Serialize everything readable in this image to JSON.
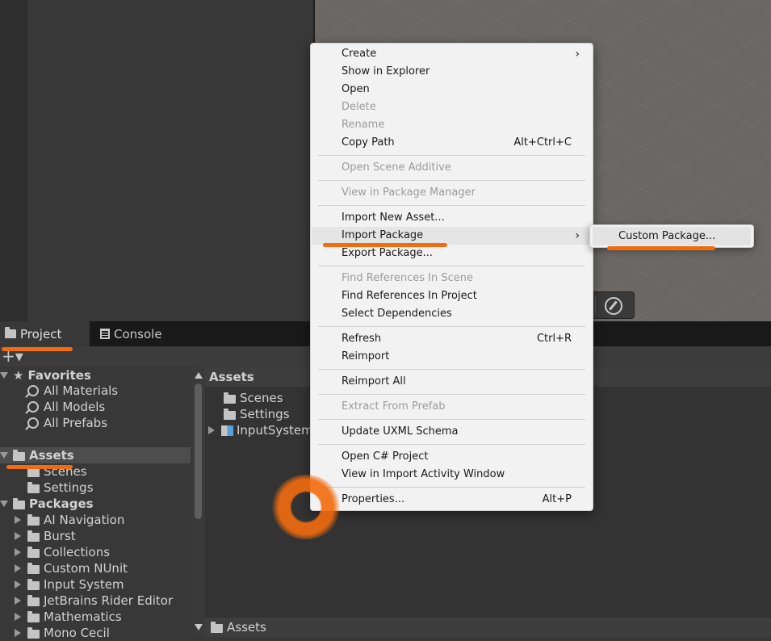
{
  "tabs": {
    "project": "Project",
    "console": "Console"
  },
  "toolbar": {
    "add_label": "+▾"
  },
  "tree": {
    "favorites": "Favorites",
    "favorite_items": [
      "All Materials",
      "All Models",
      "All Prefabs"
    ],
    "assets": "Assets",
    "asset_children": [
      "Scenes",
      "Settings"
    ],
    "packages": "Packages",
    "package_items": [
      "AI Navigation",
      "Burst",
      "Collections",
      "Custom NUnit",
      "Input System",
      "JetBrains Rider Editor",
      "Mathematics",
      "Mono Cecil"
    ]
  },
  "content": {
    "header": "Assets",
    "items": [
      "Scenes",
      "Settings",
      "InputSystem"
    ],
    "footer": "Assets"
  },
  "context_menu": {
    "items": [
      {
        "label": "Create",
        "shortcut": "",
        "submenu": true,
        "disabled": false
      },
      {
        "label": "Show in Explorer",
        "shortcut": "",
        "disabled": false
      },
      {
        "label": "Open",
        "shortcut": "",
        "disabled": false
      },
      {
        "label": "Delete",
        "shortcut": "",
        "disabled": true
      },
      {
        "label": "Rename",
        "shortcut": "",
        "disabled": true
      },
      {
        "label": "Copy Path",
        "shortcut": "Alt+Ctrl+C",
        "disabled": false
      },
      {
        "label": "Open Scene Additive",
        "shortcut": "",
        "disabled": true
      },
      {
        "label": "View in Package Manager",
        "shortcut": "",
        "disabled": true
      },
      {
        "label": "Import New Asset...",
        "shortcut": "",
        "disabled": false
      },
      {
        "label": "Import Package",
        "shortcut": "",
        "submenu": true,
        "disabled": false,
        "highlighted": true
      },
      {
        "label": "Export Package...",
        "shortcut": "",
        "disabled": false
      },
      {
        "label": "Find References In Scene",
        "shortcut": "",
        "disabled": true
      },
      {
        "label": "Find References In Project",
        "shortcut": "",
        "disabled": false
      },
      {
        "label": "Select Dependencies",
        "shortcut": "",
        "disabled": false
      },
      {
        "label": "Refresh",
        "shortcut": "Ctrl+R",
        "disabled": false
      },
      {
        "label": "Reimport",
        "shortcut": "",
        "disabled": false
      },
      {
        "label": "Reimport All",
        "shortcut": "",
        "disabled": false
      },
      {
        "label": "Extract From Prefab",
        "shortcut": "",
        "disabled": true
      },
      {
        "label": "Update UXML Schema",
        "shortcut": "",
        "disabled": false
      },
      {
        "label": "Open C# Project",
        "shortcut": "",
        "disabled": false
      },
      {
        "label": "View in Import Activity Window",
        "shortcut": "",
        "disabled": false
      },
      {
        "label": "Properties...",
        "shortcut": "Alt+P",
        "disabled": false
      }
    ],
    "submenu_arrow": "›"
  },
  "submenu": {
    "label": "Custom Package..."
  },
  "colors": {
    "annotation": "#f26b0e",
    "menu_bg": "#f2f2f2",
    "editor_bg": "#383838"
  }
}
